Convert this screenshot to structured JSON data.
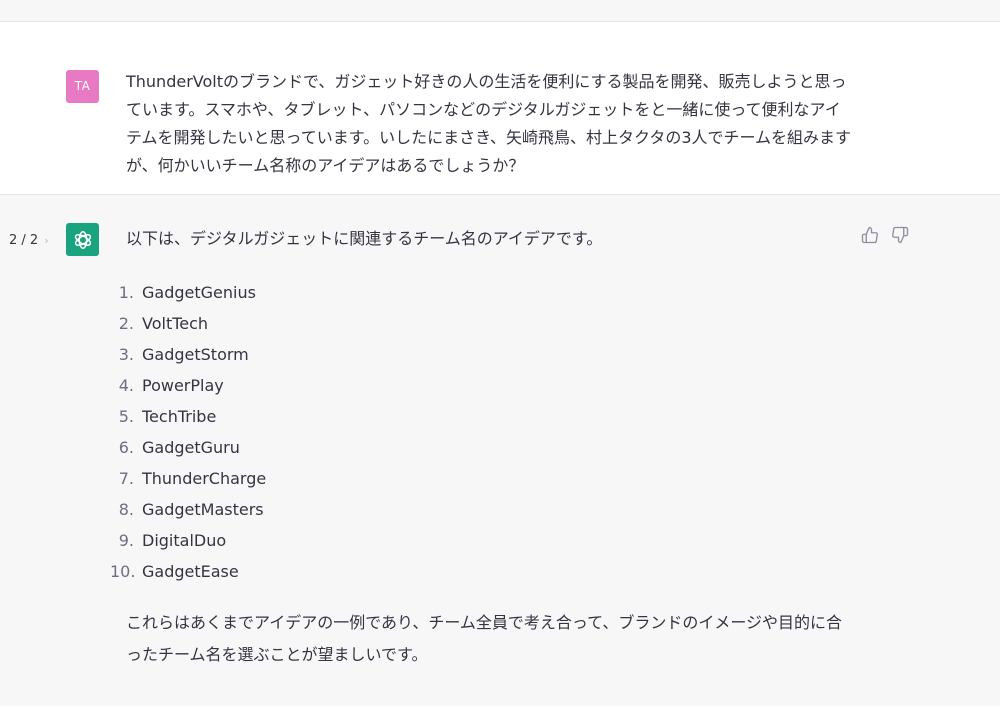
{
  "user": {
    "avatar_initials": "TA",
    "avatar_color": "#e87ac4",
    "message": "ThunderVoltのブランドで、ガジェット好きの人の生活を便利にする製品を開発、販売しようと思っています。スマホや、タブレット、パソコンなどのデジタルガジェットをと一緒に使って便利なアイテムを開発したいと思っています。いしたにまさき、矢崎飛鳥、村上タクタの3人でチームを組みますが、何かいいチーム名称のアイデアはあるでしょうか？"
  },
  "assistant": {
    "pager": {
      "current": "2 / 2",
      "next_icon": "chevron-right-icon"
    },
    "logo_color": "#19a37e",
    "logo_icon": "openai-logo-icon",
    "intro": "以下は、デジタルガジェットに関連するチーム名のアイデアです。",
    "feedback_icons": [
      "thumbs-up-icon",
      "thumbs-down-icon"
    ],
    "names": [
      {
        "num": "1.",
        "name": "GadgetGenius"
      },
      {
        "num": "2.",
        "name": "VoltTech"
      },
      {
        "num": "3.",
        "name": "GadgetStorm"
      },
      {
        "num": "4.",
        "name": "PowerPlay"
      },
      {
        "num": "5.",
        "name": "TechTribe"
      },
      {
        "num": "6.",
        "name": "GadgetGuru"
      },
      {
        "num": "7.",
        "name": "ThunderCharge"
      },
      {
        "num": "8.",
        "name": "GadgetMasters"
      },
      {
        "num": "9.",
        "name": "DigitalDuo"
      },
      {
        "num": "10.",
        "name": "GadgetEase"
      }
    ],
    "closing": "これらはあくまでアイデアの一例であり、チーム全員で考え合って、ブランドのイメージや目的に合ったチーム名を選ぶことが望ましいです。"
  }
}
